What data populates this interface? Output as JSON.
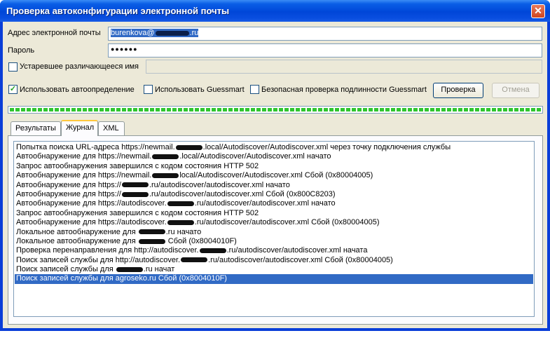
{
  "window": {
    "title": "Проверка автоконфигурации электронной почты",
    "close": "✕"
  },
  "form": {
    "email_label": "Адрес электронной почты",
    "email_value_prefix": "burenkova@",
    "email_value_suffix": ".ru",
    "password_label": "Пароль",
    "password_value": "●●●●●●",
    "legacy_label": "Устаревшее различающееся имя",
    "legacy_value": ""
  },
  "options": {
    "autodetect_label": "Использовать автоопределение",
    "autodetect_checked": true,
    "guessmart_label": "Использовать Guessmart",
    "guessmart_checked": false,
    "secure_label": "Безопасная проверка подлинности Guessmart",
    "secure_checked": false,
    "test_button": "Проверка",
    "cancel_button": "Отмена"
  },
  "progress": {
    "value": 1.0,
    "color": "#2fc52f"
  },
  "tabs": [
    {
      "label": "Результаты",
      "active": false
    },
    {
      "label": "Журнал",
      "active": true
    },
    {
      "label": "XML",
      "active": false
    }
  ],
  "log": [
    {
      "a": "Попытка поиска URL-адреса https://newmail.",
      "b": ".local/Autodiscover/Autodiscover.xml через точку подключения службы",
      "r": true
    },
    {
      "a": "Автообнаружение для https://newmail.",
      "b": ".local/Autodiscover/Autodiscover.xml начато",
      "r": true
    },
    {
      "a": "Запрос автообнаружения завершился с кодом состояния HTTP 502",
      "b": "",
      "r": false
    },
    {
      "a": "Автообнаружение для https://newmail.",
      "b": "local/Autodiscover/Autodiscover.xml Сбой (0x80004005)",
      "r": true
    },
    {
      "a": "Автообнаружение для https://",
      "b": ".ru/autodiscover/autodiscover.xml начато",
      "r": true
    },
    {
      "a": "Автообнаружение для https://",
      "b": ".ru/autodiscover/autodiscover.xml Сбой (0x800C8203)",
      "r": true
    },
    {
      "a": "Автообнаружение для https://autodiscover.",
      "b": ".ru/autodiscover/autodiscover.xml начато",
      "r": true
    },
    {
      "a": "Запрос автообнаружения завершился с кодом состояния HTTP 502",
      "b": "",
      "r": false
    },
    {
      "a": "Автообнаружение для https://autodiscover.",
      "b": ".ru/autodiscover/autodiscover.xml Сбой (0x80004005)",
      "r": true
    },
    {
      "a": "Локальное автообнаружение для ",
      "b": ".ru начато",
      "r": true
    },
    {
      "a": "Локальное автообнаружение для ",
      "b": " Сбой (0x8004010F)",
      "r": true
    },
    {
      "a": "Проверка перенаправления для http://autodiscover.",
      "b": ".ru/autodiscover/autodiscover.xml начата",
      "r": true
    },
    {
      "a": "Поиск записей службы для http://autodiscover.",
      "b": ".ru/autodiscover/autodiscover.xml Сбой (0x80004005)",
      "r": true
    },
    {
      "a": "Поиск записей службы для ",
      "b": ".ru начат",
      "r": true
    },
    {
      "a": "Поиск записей службы для agroseko.ru Сбой (0x8004010F)",
      "b": "",
      "r": false,
      "selected": true
    }
  ]
}
